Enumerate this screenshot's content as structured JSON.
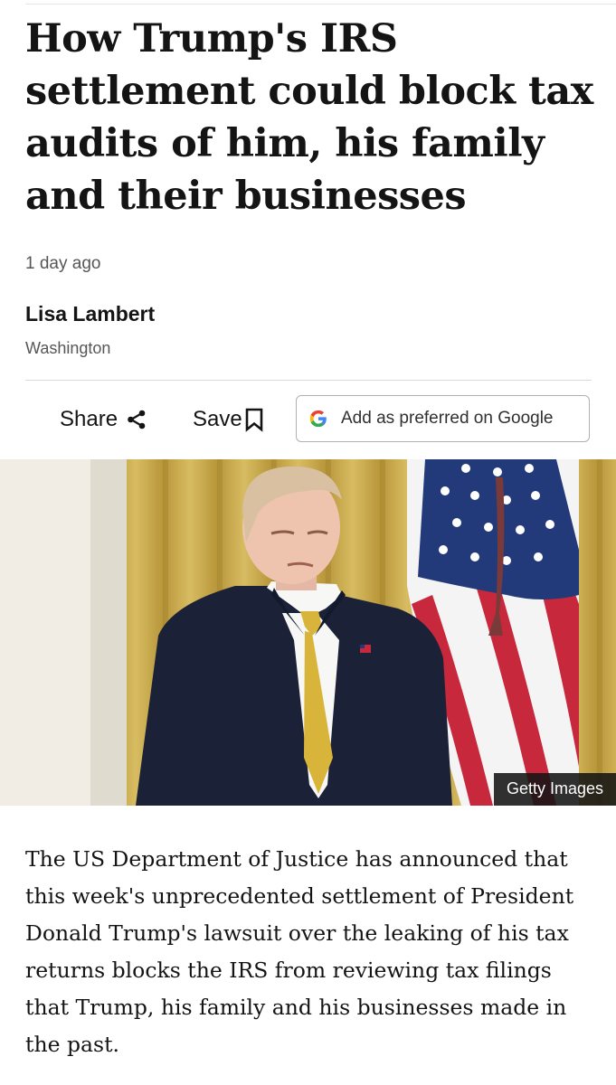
{
  "article": {
    "headline": "How Trump's IRS settlement could block tax audits of him, his family and their businesses",
    "timestamp": "1 day ago",
    "author": "Lisa Lambert",
    "location": "Washington"
  },
  "actions": {
    "share_label": "Share",
    "save_label": "Save",
    "google_label": "Add as preferred on Google"
  },
  "image": {
    "credit": "Getty Images",
    "subject": "Donald Trump standing in front of gold curtains and a US flag"
  },
  "body": {
    "paragraph_1": "The US Department of Justice has announced that this week's unprecedented settlement of President Donald Trump's lawsuit over the leaking of his tax returns blocks the IRS from reviewing tax filings that Trump, his family and his businesses made in the past."
  },
  "colors": {
    "text": "#141414",
    "muted": "#545658",
    "suit": "#1b2238",
    "tie": "#d9b43a",
    "curtain": "#c9a84a",
    "flag_blue": "#233a7a",
    "flag_red": "#c8283c"
  },
  "icons": [
    "share-icon",
    "bookmark-icon",
    "google-g-icon"
  ]
}
